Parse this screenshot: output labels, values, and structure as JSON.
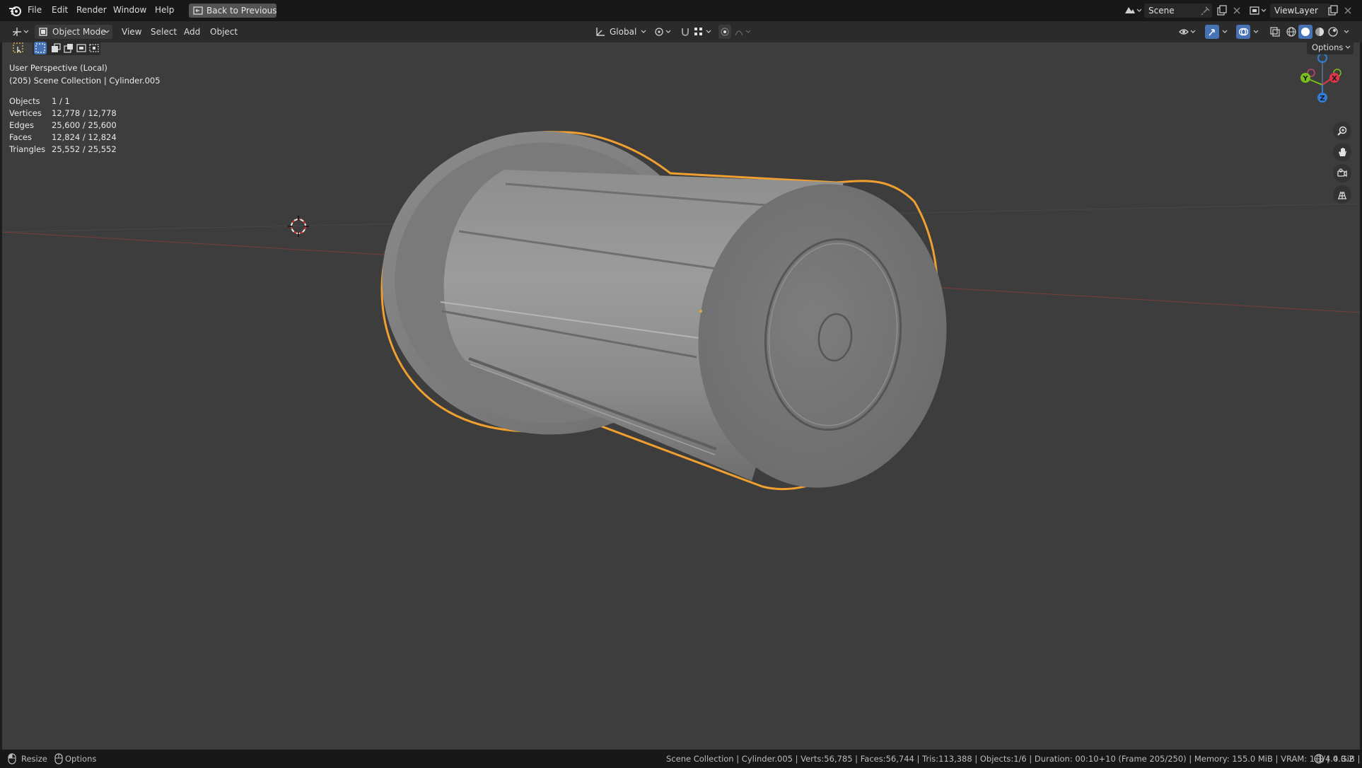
{
  "menu": {
    "file": "File",
    "edit": "Edit",
    "render": "Render",
    "window": "Window",
    "help": "Help",
    "back_to_previous": "Back to Previous"
  },
  "scene": {
    "label": "Scene"
  },
  "view_layer": {
    "label": "ViewLayer"
  },
  "header": {
    "mode": "Object Mode",
    "view": "View",
    "select": "Select",
    "add": "Add",
    "object": "Object",
    "orientation": "Global"
  },
  "viewport": {
    "perspective": "User Perspective (Local)",
    "collection_line": "(205) Scene Collection | Cylinder.005",
    "options_label": "Options",
    "stats": [
      {
        "key": "Objects",
        "value": "1 / 1"
      },
      {
        "key": "Vertices",
        "value": "12,778 / 12,778"
      },
      {
        "key": "Edges",
        "value": "25,600 / 25,600"
      },
      {
        "key": "Faces",
        "value": "12,824 / 12,824"
      },
      {
        "key": "Triangles",
        "value": "25,552 / 25,552"
      }
    ],
    "gizmo": {
      "x": "X",
      "y": "Y",
      "z": "Z"
    }
  },
  "statusbar": {
    "resize": "Resize",
    "options": "Options",
    "info": "Scene Collection | Cylinder.005 | Verts:56,785 | Faces:56,744 | Tris:113,388 | Objects:1/6 | Duration: 00:10+10 (Frame 205/250) | Memory: 155.0 MiB | VRAM: 1.1/4.0 GiB |",
    "version": "4.3.2"
  },
  "colors": {
    "viewport_bg": "#3d3d3d",
    "selection_outline": "#f0a030",
    "axis_x": "#e0344a",
    "axis_y": "#7ac11a",
    "axis_z": "#2f7ed8",
    "accent": "#4772b3"
  },
  "icons": [
    "blender-logo-icon",
    "back-icon",
    "scene-icon",
    "pin-icon",
    "new-icon",
    "close-icon",
    "view-layer-icon",
    "editor-type-icon",
    "object-mode-icon",
    "select-box-icon",
    "orientation-icon",
    "pivot-icon",
    "snap-icon",
    "snap-target-icon",
    "proportional-edit-icon",
    "falloff-icon",
    "visibility-icon",
    "gizmo-icon",
    "overlay-icon",
    "xray-icon",
    "shading-wireframe-icon",
    "shading-solid-icon",
    "shading-material-icon",
    "shading-rendered-icon",
    "zoom-icon",
    "pan-icon",
    "camera-view-icon",
    "ortho-grid-icon",
    "3d-cursor-icon",
    "mouse-left-icon",
    "mouse-right-icon",
    "globe-icon"
  ]
}
